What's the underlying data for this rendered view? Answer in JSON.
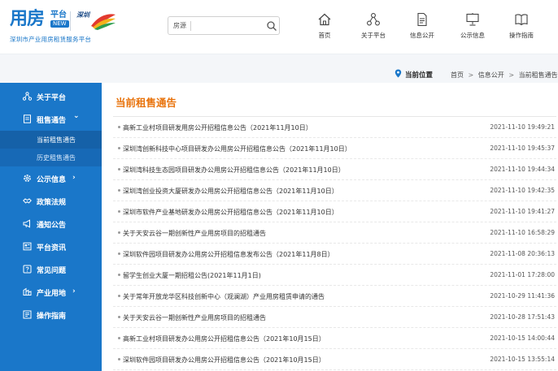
{
  "header": {
    "logo_main": "用房",
    "logo_platform": "平台",
    "logo_new": "NEW",
    "logo_subtitle": "深圳市产业用房租赁服务平台",
    "brand_logo_text": "深圳",
    "search": {
      "label": "房源",
      "placeholder": "",
      "value": ""
    },
    "nav": [
      {
        "label": "首页",
        "icon": "home-icon"
      },
      {
        "label": "关于平台",
        "icon": "network-icon"
      },
      {
        "label": "信息公开",
        "icon": "document-icon"
      },
      {
        "label": "公示信息",
        "icon": "presentation-icon"
      },
      {
        "label": "操作指南",
        "icon": "book-icon"
      }
    ]
  },
  "breadcrumb": {
    "current_label": "当前位置",
    "items": [
      "首页",
      "信息公开",
      "当前租售通告"
    ],
    "separator": ">"
  },
  "sidebar": {
    "items": [
      {
        "label": "关于平台",
        "icon": "network-icon",
        "arrow": ""
      },
      {
        "label": "租售通告",
        "icon": "document-icon",
        "arrow": "⌄"
      },
      {
        "label": "公示信息",
        "icon": "gear-icon",
        "arrow": "›"
      },
      {
        "label": "政策法规",
        "icon": "handshake-icon",
        "arrow": ""
      },
      {
        "label": "通知公告",
        "icon": "megaphone-icon",
        "arrow": ""
      },
      {
        "label": "平台资讯",
        "icon": "news-icon",
        "arrow": ""
      },
      {
        "label": "常见问题",
        "icon": "question-icon",
        "arrow": ""
      },
      {
        "label": "产业用地",
        "icon": "land-icon",
        "arrow": "›"
      },
      {
        "label": "操作指南",
        "icon": "guide-icon",
        "arrow": ""
      }
    ],
    "subitems": [
      {
        "label": "当前租售通告",
        "active": true
      },
      {
        "label": "历史租售通告",
        "active": false
      }
    ]
  },
  "main": {
    "title": "当前租售通告",
    "rows": [
      {
        "title": "高新工业村项目研发用房公开招租信息公告（2021年11月10日）",
        "date": "2021-11-10 19:49:21"
      },
      {
        "title": "深圳湾创新科技中心项目研发办公用房公开招租信息公告（2021年11月10日）",
        "date": "2021-11-10 19:45:37"
      },
      {
        "title": "深圳湾科技生态园项目研发办公用房公开招租信息公告（2021年11月10日）",
        "date": "2021-11-10 19:44:34"
      },
      {
        "title": "深圳湾创业投资大厦研发办公用房公开招租信息公告（2021年11月10日）",
        "date": "2021-11-10 19:42:35"
      },
      {
        "title": "深圳市软件产业基地研发办公用房公开招租信息公告（2021年11月10日）",
        "date": "2021-11-10 19:41:27"
      },
      {
        "title": "关于天安云谷一期创新性产业用房项目的招租通告",
        "date": "2021-11-10 16:58:29"
      },
      {
        "title": "深圳软件园项目研发办公用房公开招租信息发布公告（2021年11月8日）",
        "date": "2021-11-08 20:36:13"
      },
      {
        "title": "留学生创业大厦一期招租公告(2021年11月1日)",
        "date": "2021-11-01 17:28:00"
      },
      {
        "title": "关于常年开放龙华区科技创新中心（观澜湖）产业用房租赁申请的通告",
        "date": "2021-10-29 11:41:36"
      },
      {
        "title": "关于天安云谷一期创新性产业用房项目的招租通告",
        "date": "2021-10-28 17:51:43"
      },
      {
        "title": "高新工业村项目研发办公用房公开招租信息公告（2021年10月15日）",
        "date": "2021-10-15 14:00:44"
      },
      {
        "title": "深圳软件园项目研发办公用房公开招租信息公告（2021年10月15日）",
        "date": "2021-10-15 13:55:14"
      }
    ]
  },
  "colors": {
    "brand_blue": "#1a77c9",
    "title_orange": "#e8730c",
    "sidebar_sub": "#1769b6"
  }
}
